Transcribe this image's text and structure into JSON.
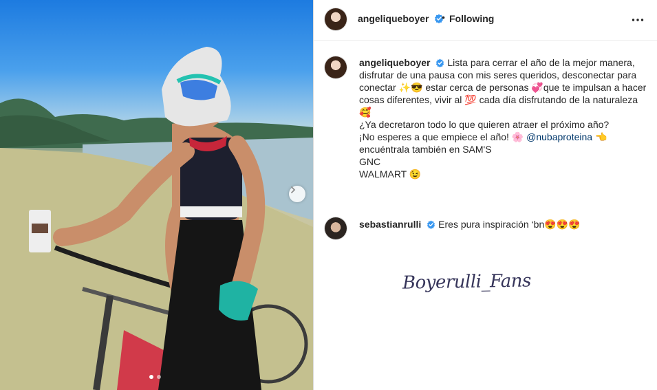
{
  "post": {
    "author": "angeliqueboyer",
    "separator": "•",
    "follow_status": "Following",
    "carousel": {
      "current_slide": 1,
      "total_slides": 2
    }
  },
  "caption": {
    "username": "angeliqueboyer",
    "lines": [
      "Lista para cerrar el año de la mejor manera,",
      "disfrutar de una pausa con mis seres queridos, desconectar para",
      "conectar ✨😎 estar cerca de personas 💞que te impulsan a hacer",
      "cosas diferentes, vivir al 💯 cada día disfrutando de la naturaleza",
      "🥰",
      "¿Ya decretaron todo lo que quieren atraer el próximo año?",
      "¡No esperes a que empiece el año! 🌸 ",
      "encuéntrala también en SAM'S",
      "GNC",
      "WALMART 😉"
    ],
    "mention": "@nubaproteina",
    "mention_suffix": " 👈"
  },
  "comment": {
    "username": "sebastianrulli",
    "text": "Eres pura inspiración ‘bn😍😍😍"
  },
  "watermark": {
    "text": "Boyerulli_Fans"
  },
  "colors": {
    "verified": "#3897f0",
    "mention": "#00376b",
    "border": "#dbdbdb"
  },
  "icons": [
    "verified-badge-icon",
    "more-options-icon",
    "chevron-right-icon"
  ]
}
